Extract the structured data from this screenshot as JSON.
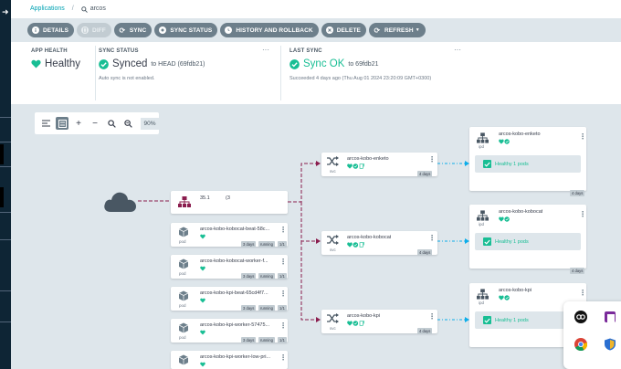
{
  "breadcrumb": {
    "root": "Applications",
    "current": "arcos"
  },
  "toolbar": {
    "details": "DETAILS",
    "diff": "DIFF",
    "sync": "SYNC",
    "sync_status": "SYNC STATUS",
    "history": "HISTORY AND ROLLBACK",
    "delete": "DELETE",
    "refresh": "REFRESH"
  },
  "status": {
    "app_health": {
      "header": "APP HEALTH",
      "value": "Healthy"
    },
    "sync_status": {
      "header": "SYNC STATUS",
      "value": "Synced",
      "to": "to HEAD (69fdb21)",
      "note": "Auto sync is not enabled."
    },
    "last_sync": {
      "header": "LAST SYNC",
      "value": "Sync OK",
      "to": "to 69fdb21",
      "note": "Succeeded 4 days ago (Thu Aug 01 2024 23:20:09 GMT+0300)"
    }
  },
  "zoom": {
    "percent": "90%"
  },
  "graph": {
    "ingress_node": {
      "title": "35.1",
      "extra": "(3",
      "kind": ""
    },
    "pods": [
      {
        "name": "arcos-kobo-kobocat-beat-58c...",
        "kind": "pod",
        "age": "3 days",
        "state": "running",
        "ready": "1/1"
      },
      {
        "name": "arcos-kobo-kobocat-worker-f...",
        "kind": "pod",
        "age": "3 days",
        "state": "running",
        "ready": "1/1"
      },
      {
        "name": "arcos-kobo-kpi-beat-65cd4f7...",
        "kind": "pod",
        "age": "3 days",
        "state": "running",
        "ready": "1/1"
      },
      {
        "name": "arcos-kobo-kpi-worker-57475...",
        "kind": "pod",
        "age": "3 days",
        "state": "running",
        "ready": "1/1"
      },
      {
        "name": "arcos-kobo-kpi-worker-low-pri...",
        "kind": "pod",
        "age": "",
        "state": "",
        "ready": ""
      }
    ],
    "services": [
      {
        "name": "arcos-kobo-enketo",
        "kind": "svc",
        "age": "4 days"
      },
      {
        "name": "arcos-kobo-kobocat",
        "kind": "svc",
        "age": "4 days"
      },
      {
        "name": "arcos-kobo-kpi",
        "kind": "svc",
        "age": "4 days"
      }
    ],
    "endpoints": [
      {
        "name": "arcos-kobo-enketo",
        "kind": "ipd",
        "health": "Healthy 1 pods",
        "age": "4 days"
      },
      {
        "name": "arcos-kobo-kobocat",
        "kind": "ipd",
        "health": "Healthy 1 pods",
        "age": "4 days"
      },
      {
        "name": "arcos-kobo-kpi",
        "kind": "ipd",
        "health": "Healthy 1 pods",
        "age": ""
      }
    ]
  },
  "colors": {
    "healthy": "#18be94",
    "link": "#00a2b3",
    "edge_ingress": "#8b1d4e",
    "edge_svc": "#0dadea"
  }
}
